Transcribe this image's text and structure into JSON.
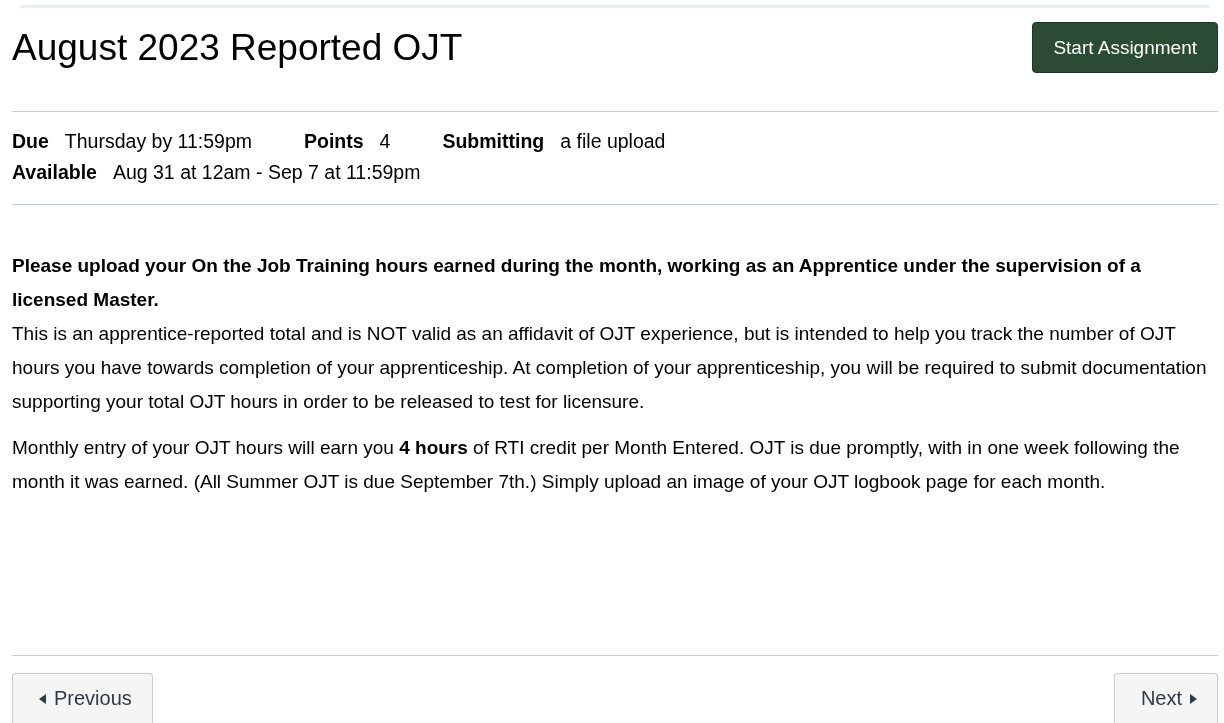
{
  "title": "August 2023 Reported OJT",
  "start_button": "Start Assignment",
  "details": [
    {
      "label": "Due",
      "value": "Thursday by 11:59pm"
    },
    {
      "label": "Points",
      "value": "4"
    },
    {
      "label": "Submitting",
      "value": "a file upload"
    },
    {
      "label": "Available",
      "value": "Aug 31 at 12am - Sep 7 at 11:59pm"
    }
  ],
  "description": {
    "lead": "Please upload your On the Job Training hours earned during the month, working as an Apprentice under the supervision of a licensed Master.",
    "paragraphs": [
      "This is an apprentice-reported total and is NOT valid as an affidavit of OJT experience, but is intended to help you track the number of OJT hours you have towards completion of your apprenticeship. At completion of your apprenticeship, you will be required to submit documentation supporting your total OJT hours in order to be released to test for licensure.",
      "Monthly entry of your OJT hours will earn you **4 hours** of RTI credit per Month Entered. OJT is due promptly, with in one week following the month it was earned.  (All Summer OJT is due September 7th.) Simply upload an image of your OJT logbook page for each month."
    ]
  },
  "navigation": {
    "previous": "Previous",
    "next": "Next"
  }
}
